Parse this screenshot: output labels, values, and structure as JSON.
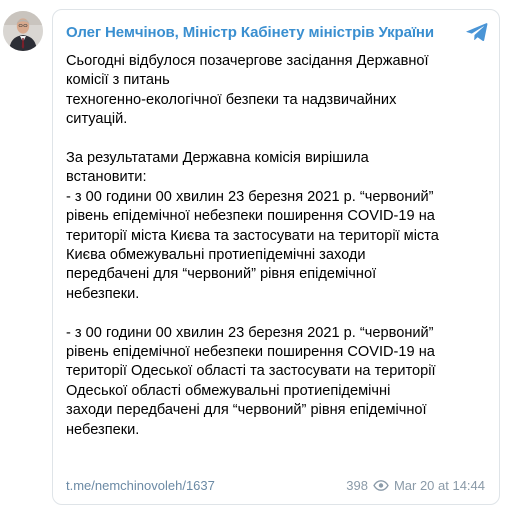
{
  "post": {
    "channel_name": "Олег Немчінов, Міністр Кабінету міністрів України",
    "paragraphs": [
      "Сьогодні відбулося позачергове засідання Державної\nкомісії з питань\nтехногенно-екологічної безпеки та надзвичайних\nситуацій.",
      "За результатами Державна комісія вирішила\nвстановити:\n- з 00 години 00 хвилин 23 березня 2021 р. “червоний”\nрівень епідемічної небезпеки поширення COVID-19 на\nтериторії міста Києва та застосувати на території міста\nКиєва обмежувальні протиепідемічні заходи\nпередбачені для “червоний” рівня епідемічної\nнебезпеки.",
      "- з 00 години 00 хвилин 23 березня 2021 р. “червоний”\nрівень епідемічної небезпеки поширення COVID-19 на\nтериторії Одеської області та застосувати на території\nОдеської області обмежувальні протиепідемічні\nзаходи передбачені для “червоний” рівня епідемічної\nнебезпеки."
    ],
    "link": "t.me/nemchinovoleh/1637",
    "views": "398",
    "date": "Mar 20 at 14:44"
  },
  "icons": {
    "avatar": "avatar-portrait",
    "logo": "telegram-icon",
    "views": "eye-icon"
  },
  "colors": {
    "channel_name": "#3a8fd0",
    "link": "#6b8aa5",
    "meta": "#8a9aa8",
    "telegram_logo": "#4a95d6",
    "border": "#dfe4e8"
  }
}
